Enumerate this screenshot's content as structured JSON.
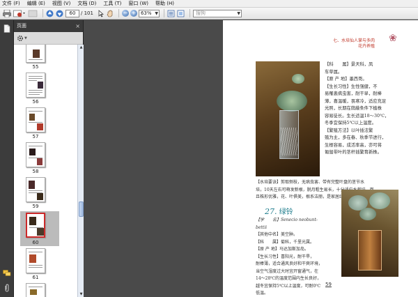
{
  "menu": [
    "文件 (F)",
    "编辑 (E)",
    "视图 (V)",
    "文档 (D)",
    "工具 (T)",
    "窗口 (W)",
    "帮助 (H)"
  ],
  "toolbar": {
    "current_page": "60",
    "total_pages": "/ 101",
    "zoom": "63%",
    "search_placeholder": "搜狗"
  },
  "panel": {
    "title": "页面"
  },
  "thumbnails": [
    {
      "label": "55"
    },
    {
      "label": "56"
    },
    {
      "label": "57"
    },
    {
      "label": "58"
    },
    {
      "label": "59"
    },
    {
      "label": "60"
    },
    {
      "label": "61"
    }
  ],
  "document": {
    "header_line1": "七、水培仙人掌与多肉",
    "header_line2": "花卉养殖",
    "para1": [
      "【科　　属】景天科，凤",
      "车草属。",
      "【原 产 地】墨西哥。",
      "【生长习性】生性强健，不",
      "易罹患病虫害，耐干旱，耐棒",
      "薄，喜温暖，畏寒冷，适应充足",
      "光照，长期在荫蔽条件下植株",
      "容易徒长。生长适温18～30℃，",
      "冬季宜保持5℃以上温度。",
      "【繁殖方法】以叶插法繁",
      "殖为主，多在春、秋季节进行，",
      "生根容易，成活率高，亦可将",
      "匍匐带叶的茎杆插繁育新株。"
    ],
    "para2": [
      "【水培要诀】剪取侧枝，无病虫害、带有完整叶盘的茎节水",
      "培，10天左右可萌发新根，脱月粗生易长，十分适应水栽培，而",
      "且株形优雅，花、叶俱美，根系洁丽，是家居绿饰的好材料。"
    ],
    "section_number": "27.",
    "section_title": "绿铃",
    "para3": [
      "【学　　名】Senecio neobunt-",
      "bettii",
      "【其他中名】美空肿。",
      "【科　　属】菊科，千里光属。",
      "【原 产 地】马达加斯加岛。",
      "【生长习性】喜阳光，耐干旱，",
      "耐棒薄，适合通风良好和干爽环境，",
      "当空气湿度过大时宜开窗通气，在",
      "14～28℃的温度范围内生长良好，",
      "越冬宜保持5℃以上温度，可耐0℃",
      "低温。"
    ],
    "page_number": "59"
  }
}
